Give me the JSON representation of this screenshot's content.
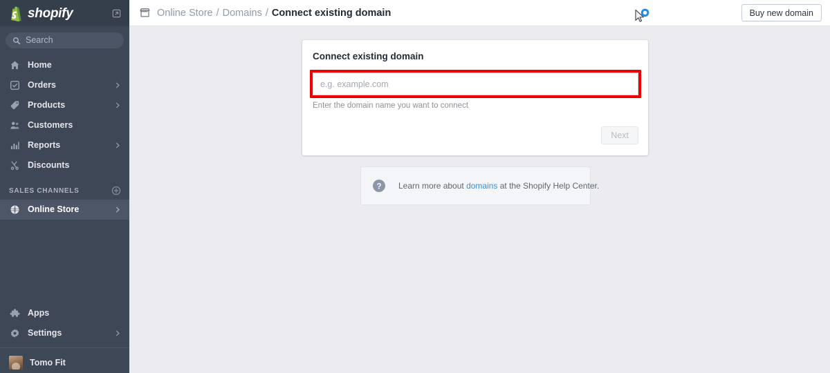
{
  "sidebar": {
    "brand": "shopify",
    "external_link_icon": "external-link-icon",
    "search": {
      "placeholder": "Search",
      "icon": "search-icon"
    },
    "nav": [
      {
        "label": "Home",
        "icon": "home-icon",
        "chevron": false,
        "active": false
      },
      {
        "label": "Orders",
        "icon": "orders-icon",
        "chevron": true,
        "active": false
      },
      {
        "label": "Products",
        "icon": "products-tag-icon",
        "chevron": true,
        "active": false
      },
      {
        "label": "Customers",
        "icon": "customers-icon",
        "chevron": false,
        "active": false
      },
      {
        "label": "Reports",
        "icon": "reports-bar-chart-icon",
        "chevron": true,
        "active": false
      },
      {
        "label": "Discounts",
        "icon": "discounts-scissors-icon",
        "chevron": false,
        "active": false
      }
    ],
    "sales_channels": {
      "title": "SALES CHANNELS",
      "add_icon": "plus-circle-icon",
      "items": [
        {
          "label": "Online Store",
          "icon": "online-store-globe-icon",
          "chevron": true,
          "active": true
        }
      ]
    },
    "bottom_nav": [
      {
        "label": "Apps",
        "icon": "apps-puzzle-icon",
        "chevron": false,
        "active": false
      },
      {
        "label": "Settings",
        "icon": "settings-gear-icon",
        "chevron": true,
        "active": false
      }
    ],
    "account": {
      "name": "Tomo Fit",
      "avatar": "user-avatar"
    }
  },
  "topbar": {
    "store_icon": "store-icon",
    "breadcrumb": [
      {
        "label": "Online Store",
        "current": false
      },
      {
        "label": "Domains",
        "current": false
      },
      {
        "label": "Connect existing domain",
        "current": true
      }
    ],
    "separator": "/",
    "buy_button": "Buy new domain"
  },
  "card": {
    "title": "Connect existing domain",
    "input": {
      "value": "",
      "placeholder": "e.g. example.com"
    },
    "helper_text": "Enter the domain name you want to connect",
    "next_button": "Next"
  },
  "help_banner": {
    "icon": "question-mark-icon",
    "text_before": "Learn more about ",
    "link": "domains",
    "text_after": " at the Shopify Help Center."
  },
  "cursor": {
    "icon": "arrow-cursor-loading",
    "spinner_color": "#1b8cf0"
  },
  "colors": {
    "sidebar_bg": "#3e4756",
    "sidebar_header_bg": "#353e4b",
    "sidebar_active_bg": "#4d5666",
    "page_bg": "#ebebf0",
    "brand_green": "#95bf47",
    "highlight_red": "#ef0000",
    "link_blue": "#3e8bd6"
  }
}
